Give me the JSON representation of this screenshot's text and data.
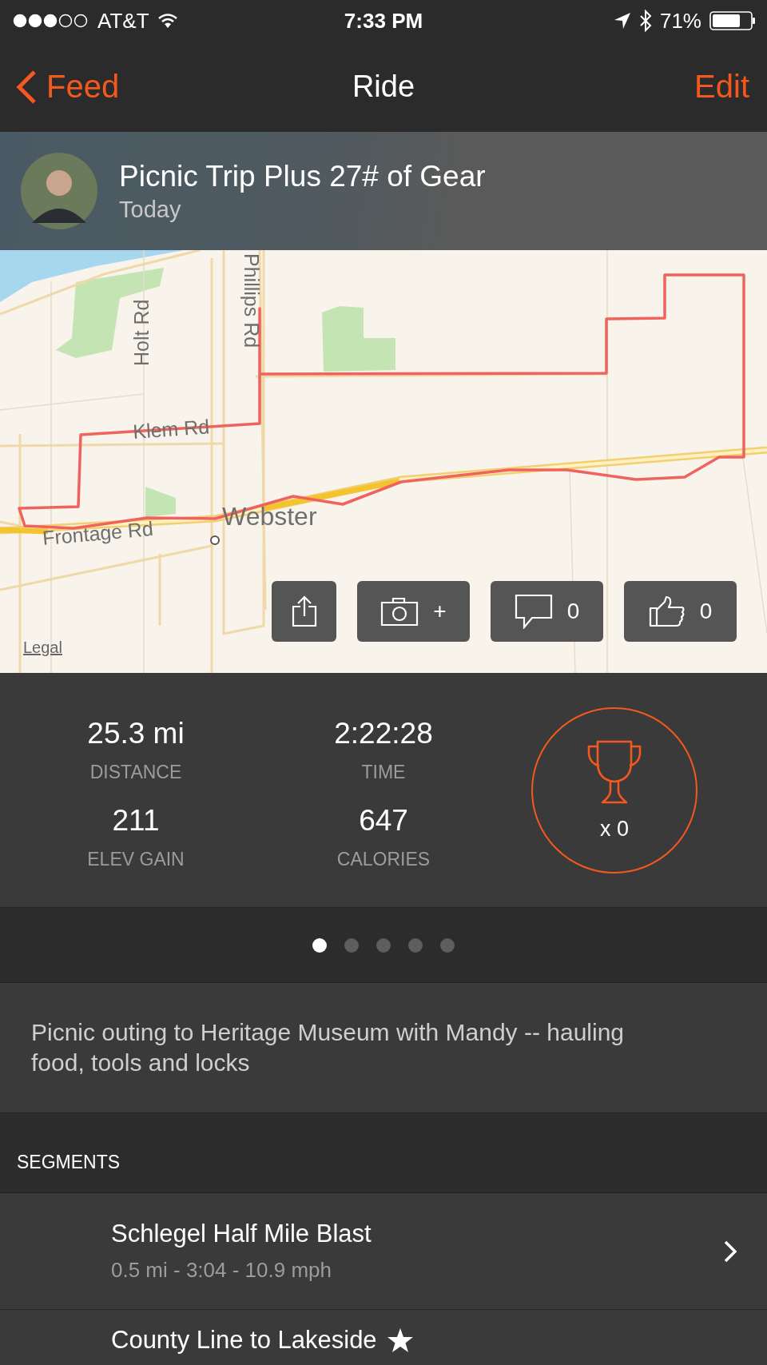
{
  "status_bar": {
    "carrier": "AT&T",
    "time": "7:33 PM",
    "battery": "71%"
  },
  "nav": {
    "back": "Feed",
    "title": "Ride",
    "action": "Edit"
  },
  "activity": {
    "title": "Picnic Trip Plus 27# of Gear",
    "date": "Today"
  },
  "map": {
    "labels": {
      "holt": "Holt Rd",
      "phillips": "Phillips Rd",
      "klem": "Klem Rd",
      "frontage": "Frontage Rd",
      "town": "Webster"
    },
    "legal": "Legal",
    "actions": [
      {
        "kind": "share"
      },
      {
        "kind": "photo",
        "text": "+"
      },
      {
        "kind": "comment",
        "text": "0"
      },
      {
        "kind": "kudos",
        "text": "0"
      }
    ]
  },
  "stats": [
    {
      "value": "25.3 mi",
      "label": "DISTANCE"
    },
    {
      "value": "2:22:28",
      "label": "TIME"
    },
    {
      "value": "211",
      "label": "ELEV GAIN"
    },
    {
      "value": "647",
      "label": "CALORIES"
    }
  ],
  "achievements": {
    "count": "x 0"
  },
  "pager": [
    {
      "selected": true
    },
    {
      "selected": false
    },
    {
      "selected": false
    },
    {
      "selected": false
    },
    {
      "selected": false
    }
  ],
  "description": "Picnic outing to Heritage Museum with Mandy -- hauling food, tools and locks",
  "segments": {
    "heading": "SEGMENTS",
    "items": [
      {
        "title": "Schlegel Half Mile Blast",
        "details": "0.5 mi - 3:04 - 10.9 mph",
        "starred": false
      },
      {
        "title": "County Line to Lakeside",
        "starred": true
      }
    ]
  }
}
